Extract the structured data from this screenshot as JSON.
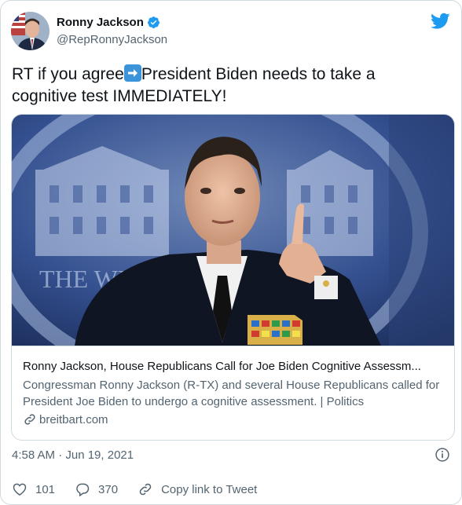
{
  "author": {
    "name": "Ronny Jackson",
    "handle": "@RepRonnyJackson"
  },
  "tweet": {
    "text_before": "RT if you agree",
    "text_after": "President Biden needs to take a cognitive test IMMEDIATELY!"
  },
  "card": {
    "title": "Ronny Jackson, House Republicans Call for Joe Biden Cognitive Assessm...",
    "description": "Congressman Ronny Jackson (R-TX) and several House Republicans called for President Joe Biden to undergo a cognitive assessment. | Politics",
    "domain": "breitbart.com",
    "image_text": "THE WH"
  },
  "meta": {
    "timestamp": "4:58 AM · Jun 19, 2021"
  },
  "actions": {
    "likes": "101",
    "replies": "370",
    "copy_link": "Copy link to Tweet"
  },
  "icons": {
    "verified": "verified-badge-icon",
    "brand": "twitter-bird-icon",
    "arrow": "right-arrow-emoji-icon",
    "link": "link-icon",
    "info": "info-icon",
    "like": "heart-icon",
    "reply": "reply-bubble-icon",
    "copy": "chain-link-icon"
  },
  "colors": {
    "brand_blue": "#1d9bf0",
    "text_primary": "#0f1419",
    "text_secondary": "#536471"
  }
}
